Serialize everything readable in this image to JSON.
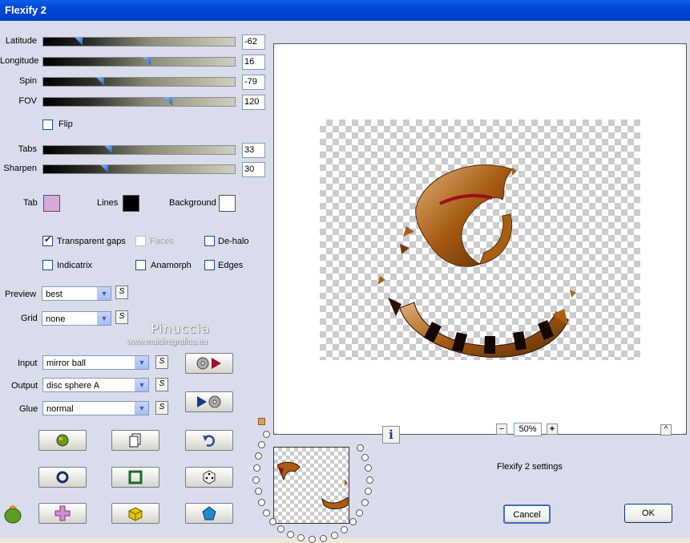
{
  "window": {
    "title": "Flexify 2"
  },
  "sliders": [
    {
      "label": "Latitude",
      "value": "-62",
      "fraction": 0.17
    },
    {
      "label": "Longitude",
      "value": "16",
      "fraction": 0.54
    },
    {
      "label": "Spin",
      "value": "-79",
      "fraction": 0.29
    },
    {
      "label": "FOV",
      "value": "120",
      "fraction": 0.66
    }
  ],
  "flip": {
    "label": "Flip",
    "checked": false
  },
  "sliders2": [
    {
      "label": "Tabs",
      "value": "33",
      "fraction": 0.33
    },
    {
      "label": "Sharpen",
      "value": "30",
      "fraction": 0.31
    }
  ],
  "colors": {
    "tab_label": "Tab",
    "tab_color": "#d8a8da",
    "lines_label": "Lines",
    "lines_color": "#000000",
    "background_label": "Background",
    "background_color": "#ffffff"
  },
  "options": {
    "transparent_gaps": "Transparent gaps",
    "faces": "Faces",
    "dehalo": "De-halo",
    "indicatrix": "Indicatrix",
    "anamorph": "Anamorph",
    "edges": "Edges"
  },
  "preview_select": {
    "label": "Preview",
    "value": "best",
    "s": "S"
  },
  "grid_select": {
    "label": "Grid",
    "value": "none",
    "s": "S"
  },
  "input_select": {
    "label": "Input",
    "value": "mirror ball",
    "s": "S"
  },
  "output_select": {
    "label": "Output",
    "value": "disc sphere A",
    "s": "S"
  },
  "glue_select": {
    "label": "Glue",
    "value": "normal",
    "s": "S"
  },
  "watermark": {
    "name": "Pinuccia",
    "site": "www.maidiregrafica.eu"
  },
  "zoom": {
    "minus": "−",
    "value": "50%",
    "plus": "+"
  },
  "info_icon": "i",
  "settings_label": "Flexify 2 settings",
  "buttons": {
    "cancel": "Cancel",
    "ok": "OK",
    "collapse": "^"
  }
}
